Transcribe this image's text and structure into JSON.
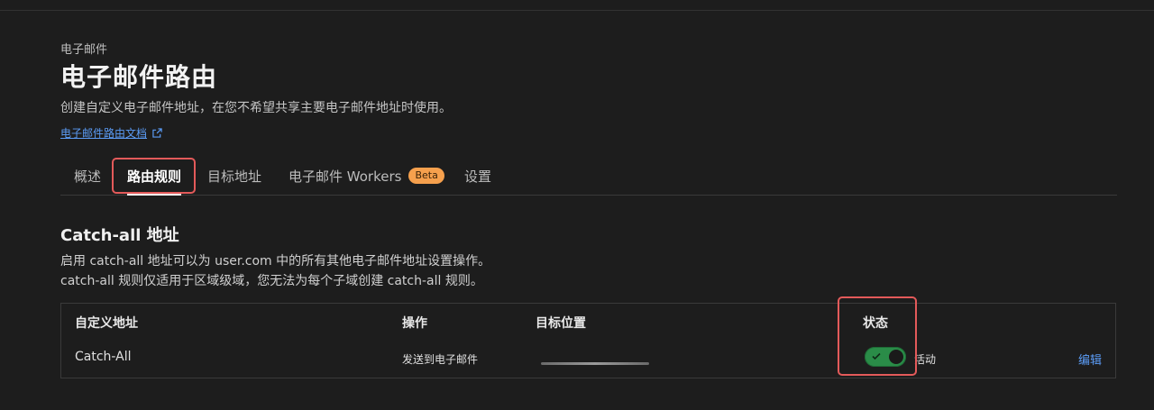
{
  "header": {
    "breadcrumb": "电子邮件",
    "title": "电子邮件路由",
    "description": "创建自定义电子邮件地址，在您不希望共享主要电子邮件地址时使用。",
    "doc_link": "电子邮件路由文档",
    "doc_link_icon": "external-link-icon"
  },
  "tabs": [
    {
      "label": "概述",
      "active": false
    },
    {
      "label": "路由规则",
      "active": true
    },
    {
      "label": "目标地址",
      "active": false
    },
    {
      "label": "电子邮件 Workers",
      "active": false,
      "badge": "Beta"
    },
    {
      "label": "设置",
      "active": false
    }
  ],
  "catch_all": {
    "title": "Catch-all 地址",
    "desc_line1": "启用 catch-all 地址可以为 user.com 中的所有其他电子邮件地址设置操作。",
    "desc_line2": "catch-all 规则仅适用于区域级域，您无法为每个子域创建 catch-all 规则。",
    "table": {
      "headers": [
        "自定义地址",
        "操作",
        "目标位置",
        "状态"
      ],
      "row": {
        "address": "Catch-All",
        "action": "发送到电子邮件",
        "destination": "",
        "status_enabled": true,
        "status_label": "活动",
        "edit_label": "编辑"
      }
    }
  },
  "colors": {
    "background": "#1d1d1d",
    "link": "#5b9cf6",
    "toggle_on": "#2a8c48",
    "badge": "#f6a04d",
    "highlight": "#e35a5a"
  }
}
